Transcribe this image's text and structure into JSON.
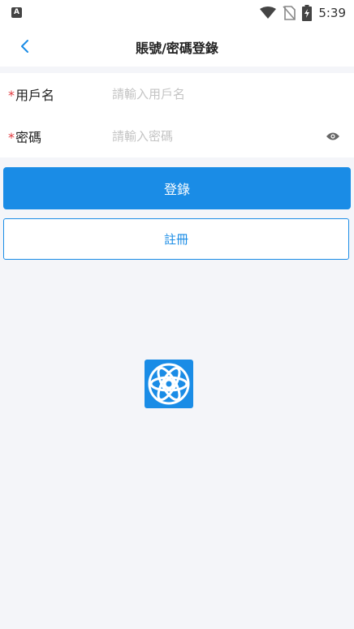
{
  "status_bar": {
    "left_icon": "a-notification-icon",
    "icons": [
      "wifi-icon",
      "no-sim-icon",
      "battery-charging-icon"
    ],
    "time": "5:39"
  },
  "app_bar": {
    "back_icon": "chevron-left-icon",
    "title": "賬號/密碼登錄"
  },
  "form": {
    "username": {
      "required_mark": "*",
      "label": "用戶名",
      "value": "",
      "placeholder": "請輸入用戶名"
    },
    "password": {
      "required_mark": "*",
      "label": "密碼",
      "value": "",
      "placeholder": "請輸入密碼",
      "toggle_icon": "eye-icon"
    }
  },
  "actions": {
    "login_label": "登錄",
    "register_label": "註冊"
  },
  "logo": {
    "icon": "app-logo-icon"
  },
  "colors": {
    "accent": "#1a8ce6",
    "required": "#e0393e",
    "background": "#f4f5f9",
    "placeholder": "#c4c4c4"
  }
}
